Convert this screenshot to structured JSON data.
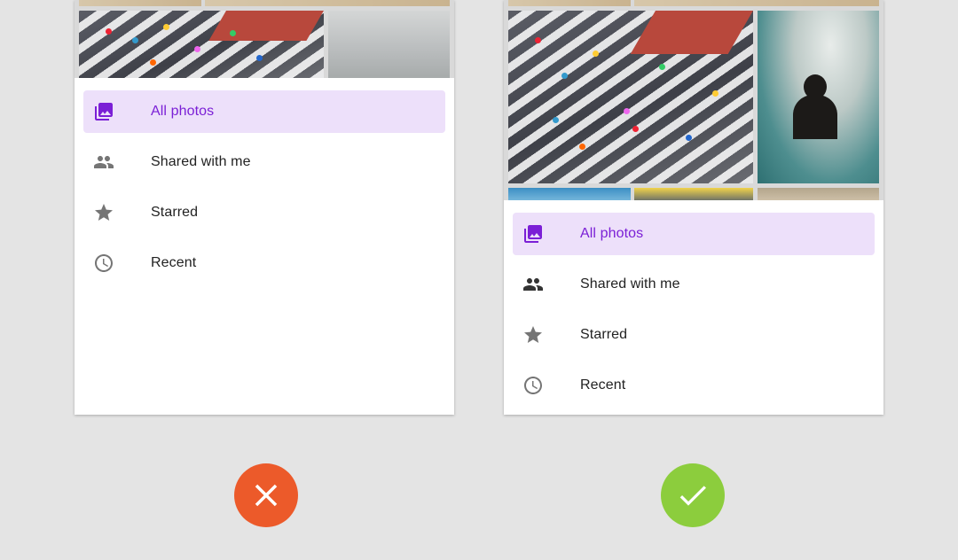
{
  "examples": [
    {
      "id": "dont",
      "menu": [
        {
          "label": "All photos",
          "icon": "photo-library-icon",
          "active": true
        },
        {
          "label": "Shared with me",
          "icon": "people-icon",
          "active": false
        },
        {
          "label": "Starred",
          "icon": "star-icon",
          "active": false
        },
        {
          "label": "Recent",
          "icon": "clock-icon",
          "active": false
        }
      ],
      "indicator": {
        "icon": "close-icon",
        "color": "#ec5a2a"
      }
    },
    {
      "id": "do",
      "menu": [
        {
          "label": "All photos",
          "icon": "photo-library-icon",
          "active": true
        },
        {
          "label": "Shared with me",
          "icon": "people-icon",
          "active": false
        },
        {
          "label": "Starred",
          "icon": "star-icon",
          "active": false
        },
        {
          "label": "Recent",
          "icon": "clock-icon",
          "active": false
        }
      ],
      "indicator": {
        "icon": "check-icon",
        "color": "#8ccd3d"
      }
    }
  ],
  "colors": {
    "accent": "#7b1fd6",
    "active_bg": "#ede0fa",
    "icon_gray": "#757575"
  }
}
